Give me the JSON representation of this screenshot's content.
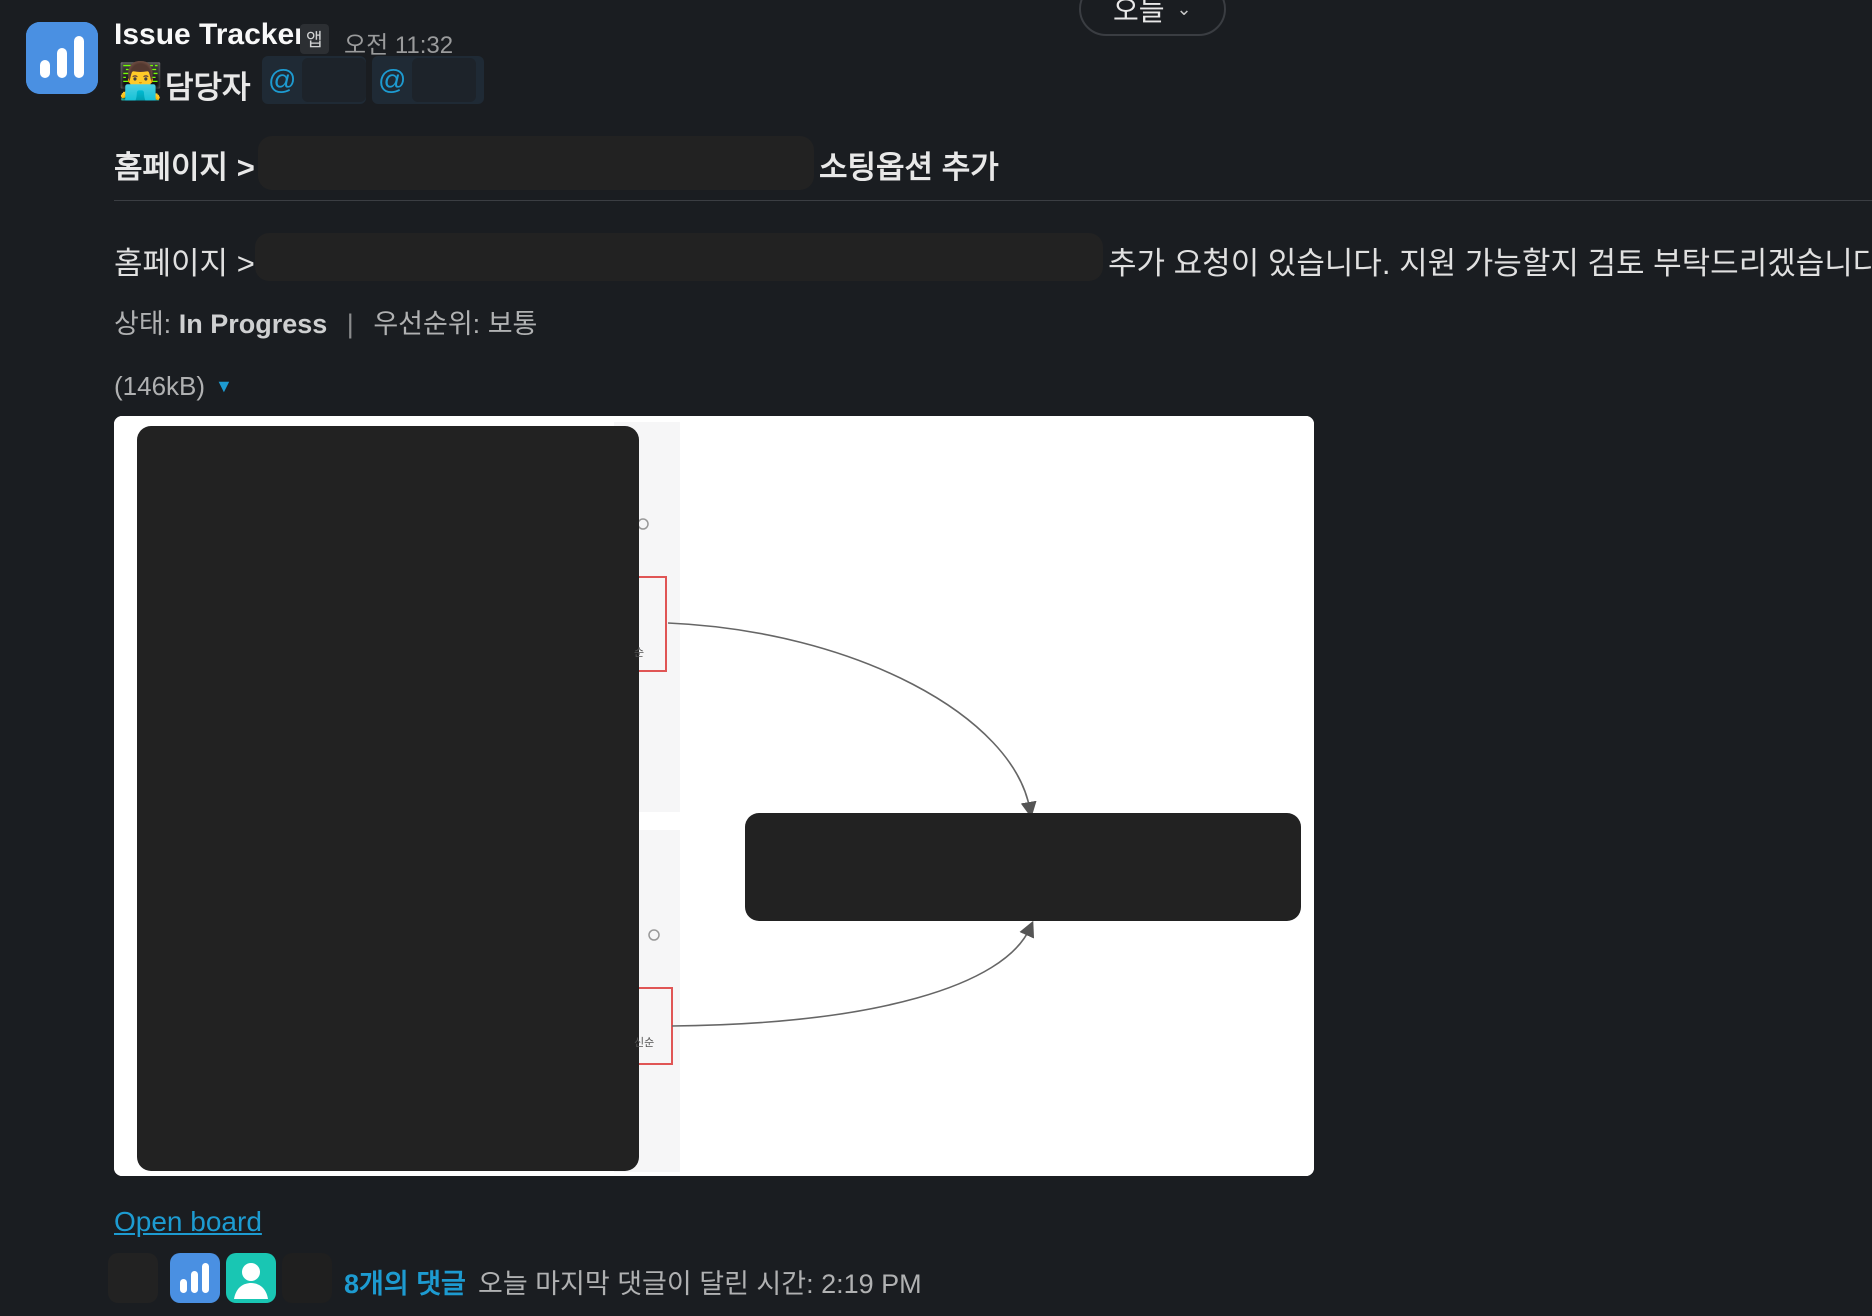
{
  "date_divider": {
    "label": "오늘"
  },
  "message": {
    "sender": "Issue Tracker",
    "app_badge": "앱",
    "timestamp": "오전 11:32",
    "assignee_emoji": "👨‍💻",
    "assignee_label": "담당자",
    "mentions": [
      "@",
      "@"
    ],
    "title_start": "홈페이지 > ",
    "title_end": "소팅옵션 추가",
    "body_start": "홈페이지 >",
    "body_end": "추가 요청이 있습니다. 지원 가능할지 검토 부탁드리겠습니다.",
    "status_label": "상태:",
    "status_value": "In Progress",
    "priority_label": "우선순위:",
    "priority_value": "보통",
    "file_size": "(146kB)",
    "attachment_labels": [
      "순",
      "신순"
    ],
    "open_board": "Open board",
    "replies_count": "8개의 댓글",
    "last_reply": "오늘 마지막 댓글이 달린 시간: 2:19 PM"
  },
  "colors": {
    "accent": "#1d9bd1",
    "background": "#1a1d21",
    "app_icon": "#4a90e2",
    "redaction": "#222222"
  }
}
